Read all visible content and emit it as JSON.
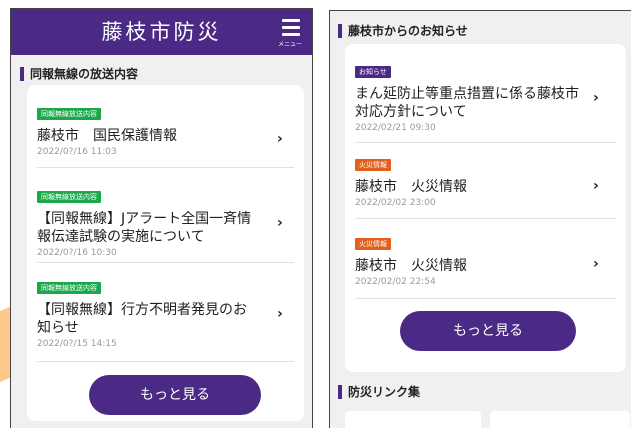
{
  "header": {
    "title": "藤枝市防災",
    "menu_label": "メニュー"
  },
  "left": {
    "section_title": "同報無線の放送内容",
    "items": [
      {
        "tag": "同報無線放送内容",
        "title": "藤枝市　国民保護情報",
        "date": "2022/0?/16 11:03"
      },
      {
        "tag": "同報無線放送内容",
        "title": "【同報無線】Jアラート全国一斉情報伝達試験の実施について",
        "date": "2022/0?/16 10:30"
      },
      {
        "tag": "同報無線放送内容",
        "title": "【同報無線】行方不明者発見のお知らせ",
        "date": "2022/0?/15 14:15"
      }
    ],
    "more_label": "もっと見る"
  },
  "right": {
    "section_title": "藤枝市からのお知らせ",
    "items": [
      {
        "tag": "お知らせ",
        "title": "まん延防止等重点措置に係る藤枝市対応方針について",
        "date": "2022/02/21 09:30"
      },
      {
        "tag": "火災情報",
        "title": "藤枝市　火災情報",
        "date": "2022/02/02 23:00"
      },
      {
        "tag": "火災情報",
        "title": "藤枝市　火災情報",
        "date": "2022/02/02 22:54"
      }
    ],
    "more_label": "もっと見る",
    "links_title": "防災リンク集"
  },
  "colors": {
    "brand_purple": "#4b2a86",
    "tag_green": "#1aa84a",
    "tag_orange": "#e0601c",
    "arrow_orange": "#fcc98a"
  },
  "icons": {
    "menu": "hamburger-menu-icon",
    "chevron": "chevron-right-icon"
  }
}
